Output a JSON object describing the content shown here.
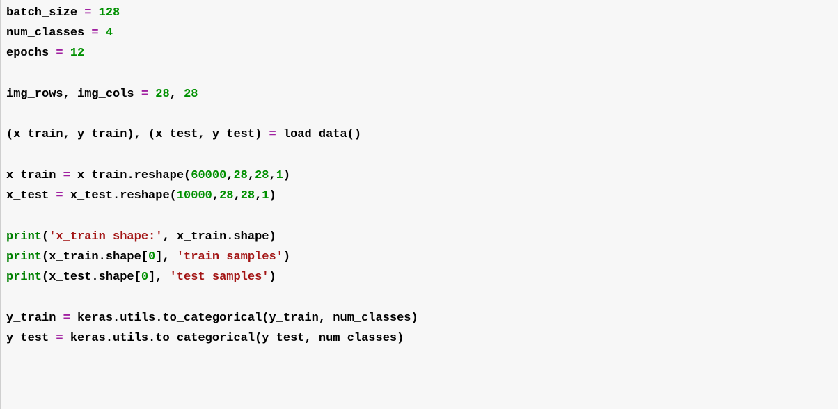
{
  "code": {
    "tokens": [
      [
        {
          "cls": "",
          "t": "batch_size "
        },
        {
          "cls": "op",
          "t": "="
        },
        {
          "cls": "",
          "t": " "
        },
        {
          "cls": "num",
          "t": "128"
        }
      ],
      [
        {
          "cls": "",
          "t": "num_classes "
        },
        {
          "cls": "op",
          "t": "="
        },
        {
          "cls": "",
          "t": " "
        },
        {
          "cls": "num",
          "t": "4"
        }
      ],
      [
        {
          "cls": "",
          "t": "epochs "
        },
        {
          "cls": "op",
          "t": "="
        },
        {
          "cls": "",
          "t": " "
        },
        {
          "cls": "num",
          "t": "12"
        }
      ],
      [],
      [
        {
          "cls": "",
          "t": "img_rows, img_cols "
        },
        {
          "cls": "op",
          "t": "="
        },
        {
          "cls": "",
          "t": " "
        },
        {
          "cls": "num",
          "t": "28"
        },
        {
          "cls": "",
          "t": ", "
        },
        {
          "cls": "num",
          "t": "28"
        }
      ],
      [],
      [
        {
          "cls": "",
          "t": "(x_train, y_train), (x_test, y_test) "
        },
        {
          "cls": "op",
          "t": "="
        },
        {
          "cls": "",
          "t": " load_data()"
        }
      ],
      [],
      [
        {
          "cls": "",
          "t": "x_train "
        },
        {
          "cls": "op",
          "t": "="
        },
        {
          "cls": "",
          "t": " x_train.reshape("
        },
        {
          "cls": "num",
          "t": "60000"
        },
        {
          "cls": "",
          "t": ","
        },
        {
          "cls": "num",
          "t": "28"
        },
        {
          "cls": "",
          "t": ","
        },
        {
          "cls": "num",
          "t": "28"
        },
        {
          "cls": "",
          "t": ","
        },
        {
          "cls": "num",
          "t": "1"
        },
        {
          "cls": "",
          "t": ")"
        }
      ],
      [
        {
          "cls": "",
          "t": "x_test "
        },
        {
          "cls": "op",
          "t": "="
        },
        {
          "cls": "",
          "t": " x_test.reshape("
        },
        {
          "cls": "num",
          "t": "10000"
        },
        {
          "cls": "",
          "t": ","
        },
        {
          "cls": "num",
          "t": "28"
        },
        {
          "cls": "",
          "t": ","
        },
        {
          "cls": "num",
          "t": "28"
        },
        {
          "cls": "",
          "t": ","
        },
        {
          "cls": "num",
          "t": "1"
        },
        {
          "cls": "",
          "t": ")"
        }
      ],
      [],
      [
        {
          "cls": "fn",
          "t": "print"
        },
        {
          "cls": "",
          "t": "("
        },
        {
          "cls": "str",
          "t": "'x_train shape:'"
        },
        {
          "cls": "",
          "t": ", x_train.shape)"
        }
      ],
      [
        {
          "cls": "fn",
          "t": "print"
        },
        {
          "cls": "",
          "t": "(x_train.shape["
        },
        {
          "cls": "num",
          "t": "0"
        },
        {
          "cls": "",
          "t": "], "
        },
        {
          "cls": "str",
          "t": "'train samples'"
        },
        {
          "cls": "",
          "t": ")"
        }
      ],
      [
        {
          "cls": "fn",
          "t": "print"
        },
        {
          "cls": "",
          "t": "(x_test.shape["
        },
        {
          "cls": "num",
          "t": "0"
        },
        {
          "cls": "",
          "t": "], "
        },
        {
          "cls": "str",
          "t": "'test samples'"
        },
        {
          "cls": "",
          "t": ")"
        }
      ],
      [],
      [
        {
          "cls": "",
          "t": "y_train "
        },
        {
          "cls": "op",
          "t": "="
        },
        {
          "cls": "",
          "t": " keras.utils.to_categorical(y_train, num_classes)"
        }
      ],
      [
        {
          "cls": "",
          "t": "y_test "
        },
        {
          "cls": "op",
          "t": "="
        },
        {
          "cls": "",
          "t": " keras.utils.to_categorical(y_test, num_classes)"
        }
      ]
    ]
  }
}
